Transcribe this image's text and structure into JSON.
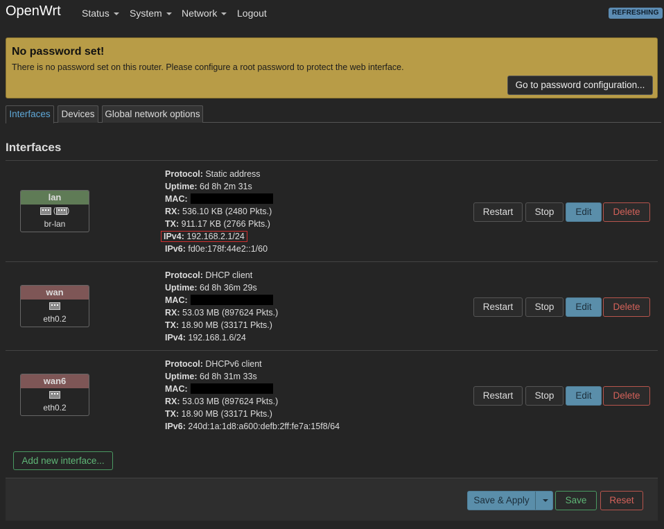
{
  "header": {
    "brand": "OpenWrt",
    "menu": [
      {
        "label": "Status"
      },
      {
        "label": "System"
      },
      {
        "label": "Network"
      },
      {
        "label": "Logout"
      }
    ],
    "badge": "REFRESHING"
  },
  "alert": {
    "title": "No password set!",
    "text": "There is no password set on this router. Please configure a root password to protect the web interface.",
    "button": "Go to password configuration..."
  },
  "tabs": [
    {
      "label": "Interfaces",
      "active": true
    },
    {
      "label": "Devices",
      "active": false
    },
    {
      "label": "Global network options",
      "active": false
    }
  ],
  "section_title": "Interfaces",
  "interfaces": [
    {
      "name": "lan",
      "device": "br-lan",
      "icons": "bridge + ethernet",
      "status_color": "#5f7b56",
      "protocol": "Static address",
      "uptime": "6d 8h 2m 31s",
      "mac": "",
      "rx": "536.10 KB (2480 Pkts.)",
      "tx": "911.17 KB (2766 Pkts.)",
      "ipv4": "192.168.2.1/24",
      "ipv6": "fd0e:178f:44e2::1/60"
    },
    {
      "name": "wan",
      "device": "eth0.2",
      "icons": "ethernet",
      "status_color": "#7e5656",
      "protocol": "DHCP client",
      "uptime": "6d 8h 36m 29s",
      "mac": "",
      "rx": "53.03 MB (897624 Pkts.)",
      "tx": "18.90 MB (33171 Pkts.)",
      "ipv4": "192.168.1.6/24"
    },
    {
      "name": "wan6",
      "device": "eth0.2",
      "icons": "ethernet",
      "status_color": "#7e5656",
      "protocol": "DHCPv6 client",
      "uptime": "6d 8h 31m 33s",
      "mac": "",
      "rx": "53.03 MB (897624 Pkts.)",
      "tx": "18.90 MB (33171 Pkts.)",
      "ipv6": "240d:1a:1d8:a600:defb:2ff:fe7a:15f8/64"
    }
  ],
  "labels": {
    "protocol": "Protocol:",
    "uptime": "Uptime:",
    "mac": "MAC:",
    "rx": "RX:",
    "tx": "TX:",
    "ipv4": "IPv4:",
    "ipv6": "IPv6:"
  },
  "row_buttons": {
    "restart": "Restart",
    "stop": "Stop",
    "edit": "Edit",
    "delete": "Delete"
  },
  "add_interface": "Add new interface...",
  "footer": {
    "save_apply": "Save & Apply",
    "save": "Save",
    "reset": "Reset"
  },
  "colors": {
    "accent": "#5a8eaa",
    "positive": "#5fb777",
    "negative": "#d5625a",
    "warning_bg": "#b89c47"
  }
}
